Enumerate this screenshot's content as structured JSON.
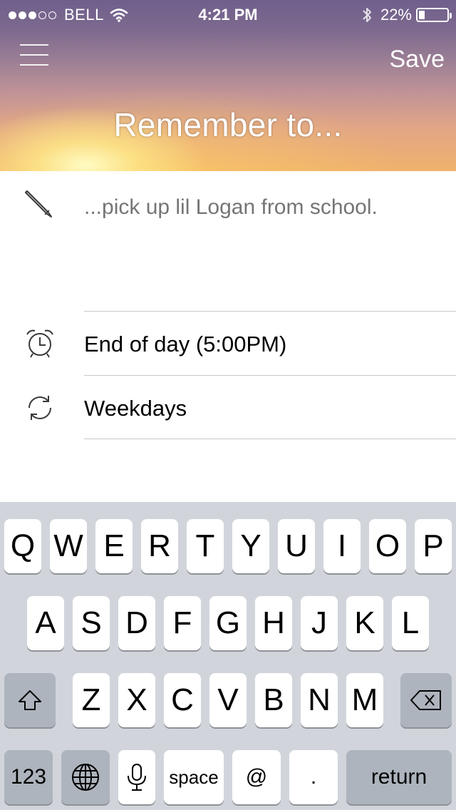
{
  "status_bar": {
    "carrier": "BELL",
    "time": "4:21 PM",
    "battery_percent": "22%",
    "battery_level": 0.22,
    "signal_bars_filled": 3,
    "signal_bars_total": 5
  },
  "header": {
    "title": "Remember to...",
    "save_label": "Save",
    "menu_icon": "hamburger-menu-icon"
  },
  "task": {
    "placeholder": "...pick up lil Logan from school.",
    "icon": "pencil-icon"
  },
  "reminder": {
    "time_label": "End of day (5:00PM)",
    "time_icon": "alarm-clock-icon",
    "repeat_label": "Weekdays",
    "repeat_icon": "repeat-icon"
  },
  "keyboard": {
    "row1": [
      "Q",
      "W",
      "E",
      "R",
      "T",
      "Y",
      "U",
      "I",
      "O",
      "P"
    ],
    "row2": [
      "A",
      "S",
      "D",
      "F",
      "G",
      "H",
      "J",
      "K",
      "L"
    ],
    "row3": [
      "Z",
      "X",
      "C",
      "V",
      "B",
      "N",
      "M"
    ],
    "numbers_label": "123",
    "space_label": "space",
    "at_label": "@",
    "period_label": ".",
    "return_label": "return"
  }
}
